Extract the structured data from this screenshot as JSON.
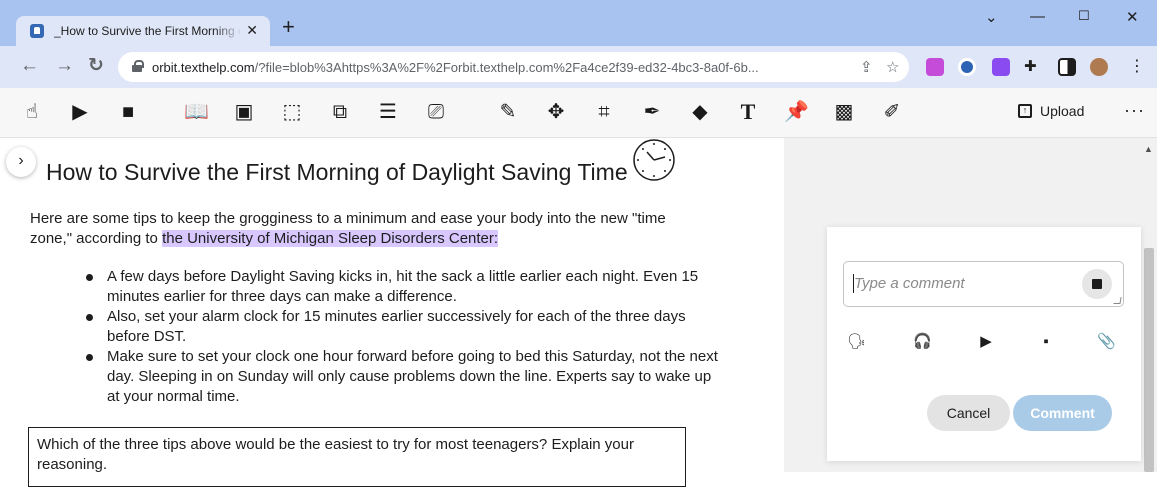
{
  "browser": {
    "tab_title": "_How to Survive the First Morning of Daylight Saving Time",
    "new_tab": "+",
    "url_host": "orbit.texthelp.com",
    "url_rest": "/?file=blob%3Ahttps%3A%2F%2Forbit.texthelp.com%2Fa4ce2f39-ed32-4bc3-8a0f-6b..."
  },
  "toolbar": {
    "upload_label": "Upload",
    "more_label": "···"
  },
  "document": {
    "title": "How to Survive the First Morning of Daylight Saving Time",
    "intro_before": "Here are some tips to keep the grogginess to a minimum and ease your body into the new \"time zone,\" according to ",
    "intro_link": "the University of Michigan Sleep Disorders Center:",
    "tips": [
      "A few days before Daylight Saving kicks in, hit the sack a little earlier each night. Even 15 minutes earlier for three days can make a difference.",
      "Also, set your alarm clock for 15 minutes earlier successively for each of the three days before DST.",
      "Make sure to set your clock one hour forward before going to bed this Saturday, not the next day. Sleeping in on Sunday will only cause problems down the line. Experts say to wake up at your normal time."
    ],
    "question": "Which of the three tips above would be the easiest to try for most teenagers?  Explain your reasoning."
  },
  "comment_panel": {
    "placeholder": "Type a comment",
    "cancel_label": "Cancel",
    "comment_label": "Comment"
  },
  "colors": {
    "highlight": "#d8c8ff",
    "comment_button": "#a9cbe8",
    "chrome_frame": "#a9c3f0"
  }
}
